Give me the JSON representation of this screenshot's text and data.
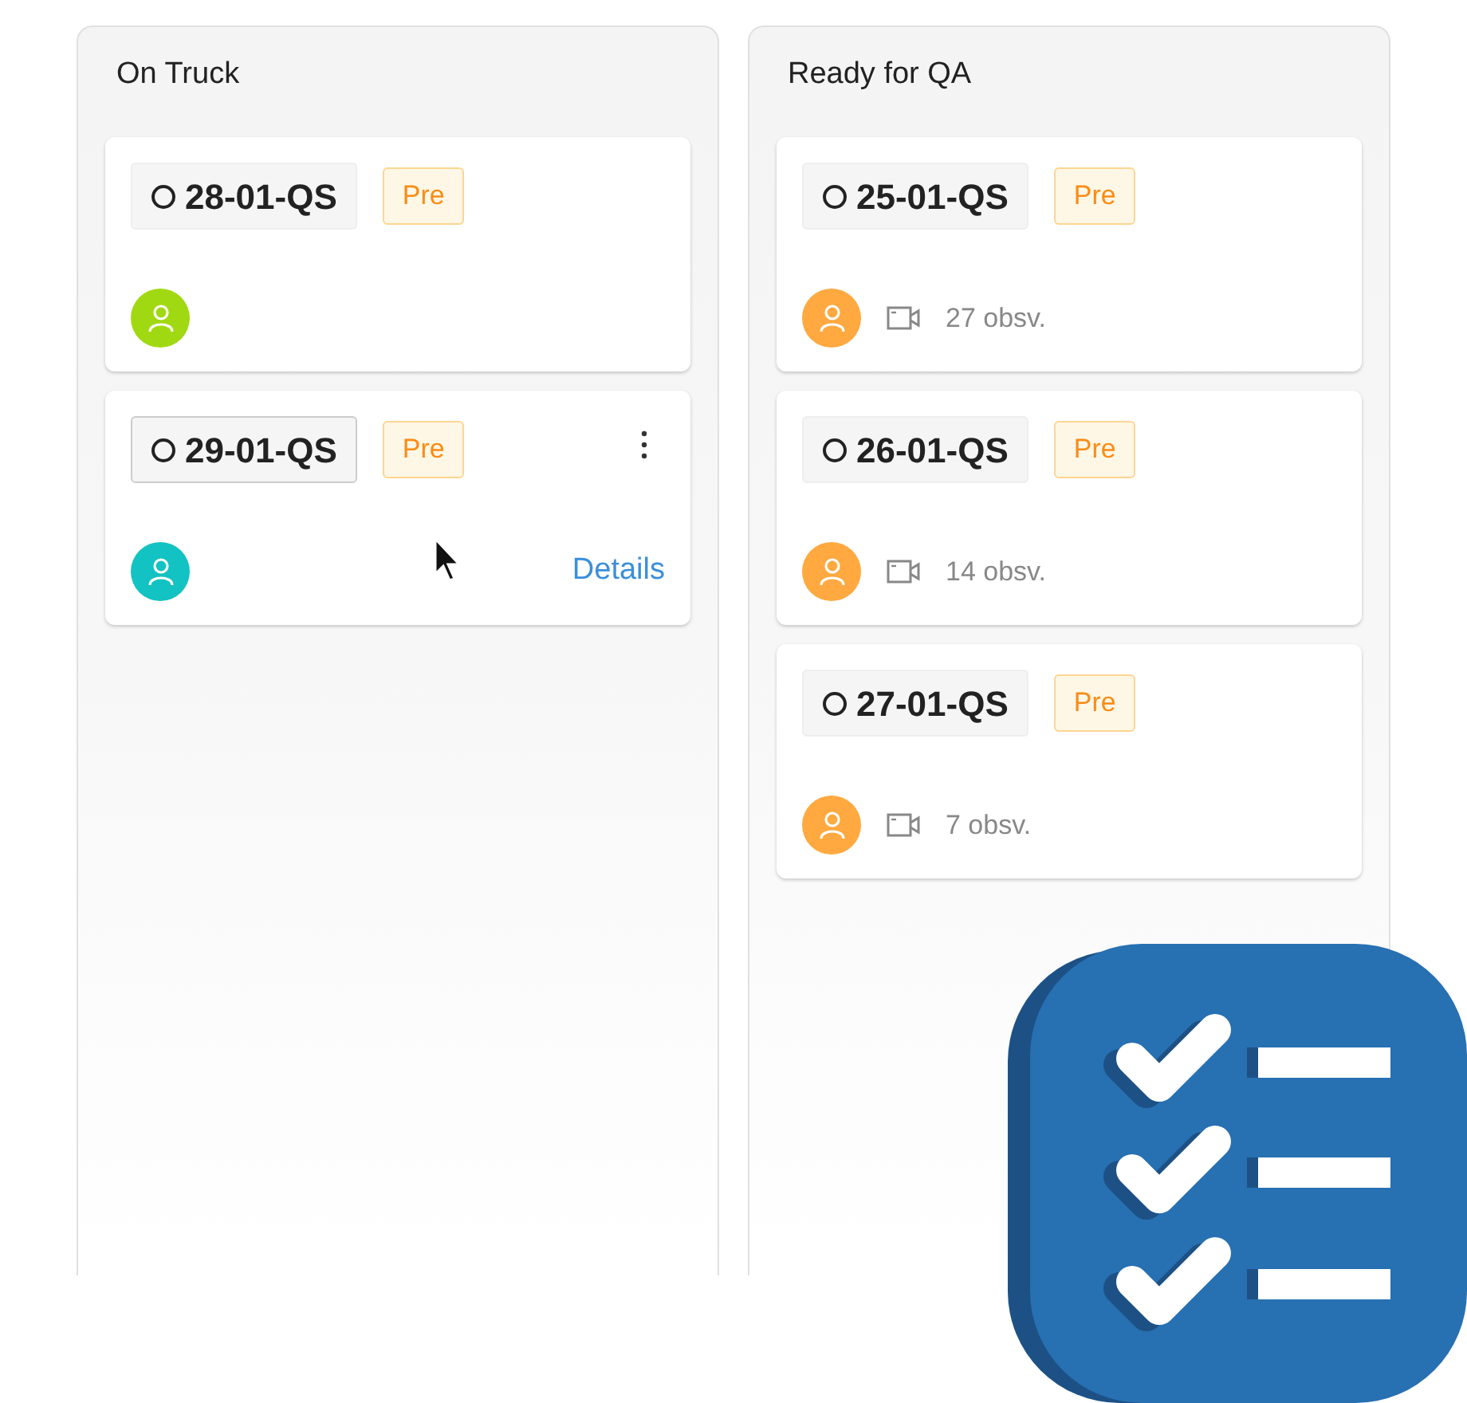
{
  "columns": [
    {
      "title": "On Truck",
      "cards": [
        {
          "code": "28-01-QS",
          "tag": "Pre",
          "color": "#a0d911",
          "hovered": false
        },
        {
          "code": "29-01-QS",
          "tag": "Pre",
          "color": "#13c2c2",
          "hovered": true,
          "link": "Details"
        }
      ]
    },
    {
      "title": "Ready for QA",
      "cards": [
        {
          "code": "25-01-QS",
          "tag": "Pre",
          "color": "#ffa940",
          "hovered": false,
          "observations": "27 obsv."
        },
        {
          "code": "26-01-QS",
          "tag": "Pre",
          "color": "#ffa940",
          "hovered": false,
          "observations": "14 obsv."
        },
        {
          "code": "27-01-QS",
          "tag": "Pre",
          "color": "#ffa940",
          "hovered": false,
          "observations": "7 obsv."
        }
      ]
    }
  ]
}
